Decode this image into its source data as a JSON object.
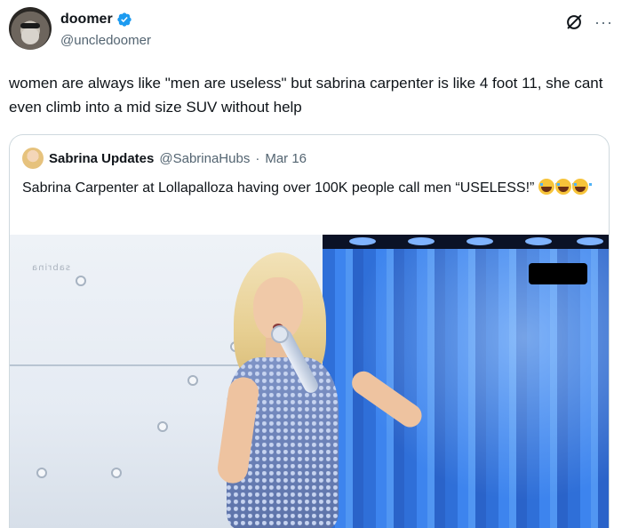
{
  "tweet": {
    "author": {
      "display_name": "doomer",
      "handle": "@uncledoomer",
      "verified": true
    },
    "text": "women are always like \"men are useless\" but sabrina carpenter is like 4 foot 11, she cant even climb into a mid size SUV without help",
    "icons": [
      "grok-icon",
      "more-icon"
    ],
    "more_label": "···"
  },
  "quote": {
    "author": {
      "display_name": "Sabrina Updates",
      "handle": "@SabrinaHubs",
      "separator": "·",
      "date": "Mar 16"
    },
    "text": "Sabrina Carpenter at Lollapalloza having over 100K people call men “USELESS!”",
    "emoji_count": 3,
    "emoji_name": "loudly-crying-face",
    "media": {
      "watermark": "sabrina",
      "description_colors": {
        "left_backdrop": "#e5ebf3",
        "right_backdrop": "#3d84ee",
        "redaction": "#000000"
      }
    }
  },
  "colors": {
    "text_primary": "#0f1419",
    "text_secondary": "#536471",
    "verified_blue": "#1d9bf0",
    "border": "#cfd9de"
  }
}
